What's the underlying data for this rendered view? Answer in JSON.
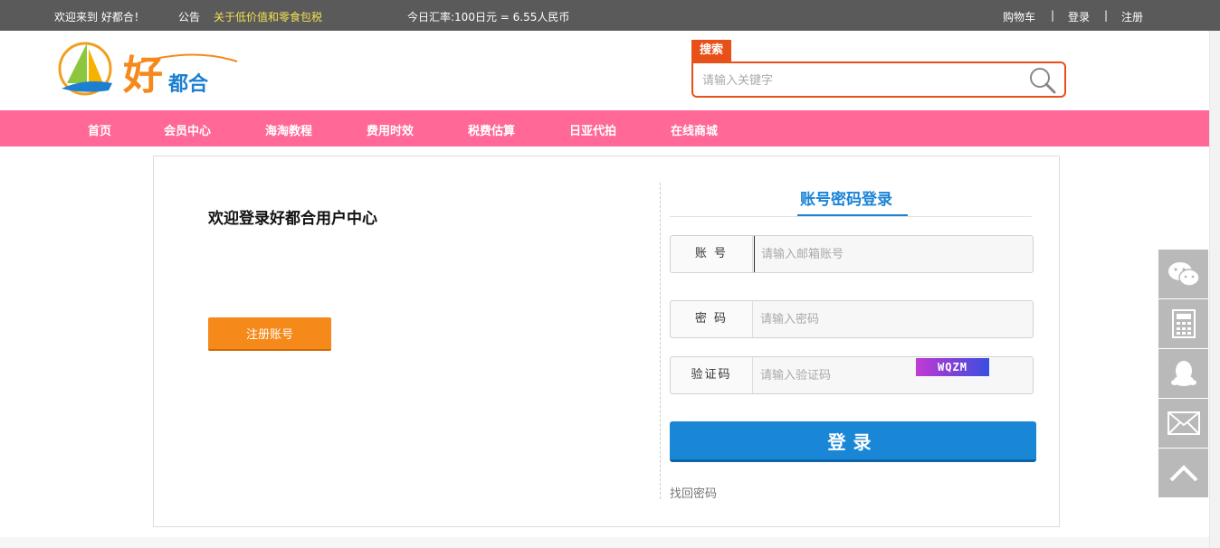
{
  "topbar": {
    "welcome": "欢迎来到  好都合！",
    "notice_label": "公告",
    "notice_text": "关于低价值和零食包税",
    "exchange_rate": "今日汇率:100日元 = 6.55人民币",
    "cart": "购物车",
    "separator": "|",
    "login": "登录",
    "register": "注册"
  },
  "logo": {
    "big_char": "好",
    "small_chars": "都合"
  },
  "search": {
    "tab_label": "搜索",
    "placeholder": "请输入关键字"
  },
  "nav": {
    "items": [
      {
        "label": "首页"
      },
      {
        "label": "会员中心"
      },
      {
        "label": "海淘教程"
      },
      {
        "label": "费用时效"
      },
      {
        "label": "税费估算"
      },
      {
        "label": "日亚代拍"
      },
      {
        "label": "在线商城"
      }
    ]
  },
  "left": {
    "welcome_title": "欢迎登录好都合用户中心",
    "register_button": "注册账号"
  },
  "login": {
    "tab_label": "账号密码登录",
    "account_label": "账 号",
    "account_placeholder": "请输入邮箱账号",
    "password_label": "密 码",
    "password_placeholder": "请输入密码",
    "captcha_label": "验证码",
    "captcha_placeholder": "请输入验证码",
    "captcha_text": "WQZM",
    "submit_label": "登录",
    "forgot_link": "找回密码"
  },
  "side_tools": [
    "wechat-icon",
    "calculator-icon",
    "qq-icon",
    "mail-icon",
    "back-to-top-icon"
  ],
  "colors": {
    "topbar_bg": "#5a5a5a",
    "notice": "#f5e150",
    "search_accent": "#e8501a",
    "nav_bg": "#ff6897",
    "login_blue": "#1a86d6",
    "register_orange": "#f5891a",
    "side_tool_bg": "#b9b9b9"
  }
}
